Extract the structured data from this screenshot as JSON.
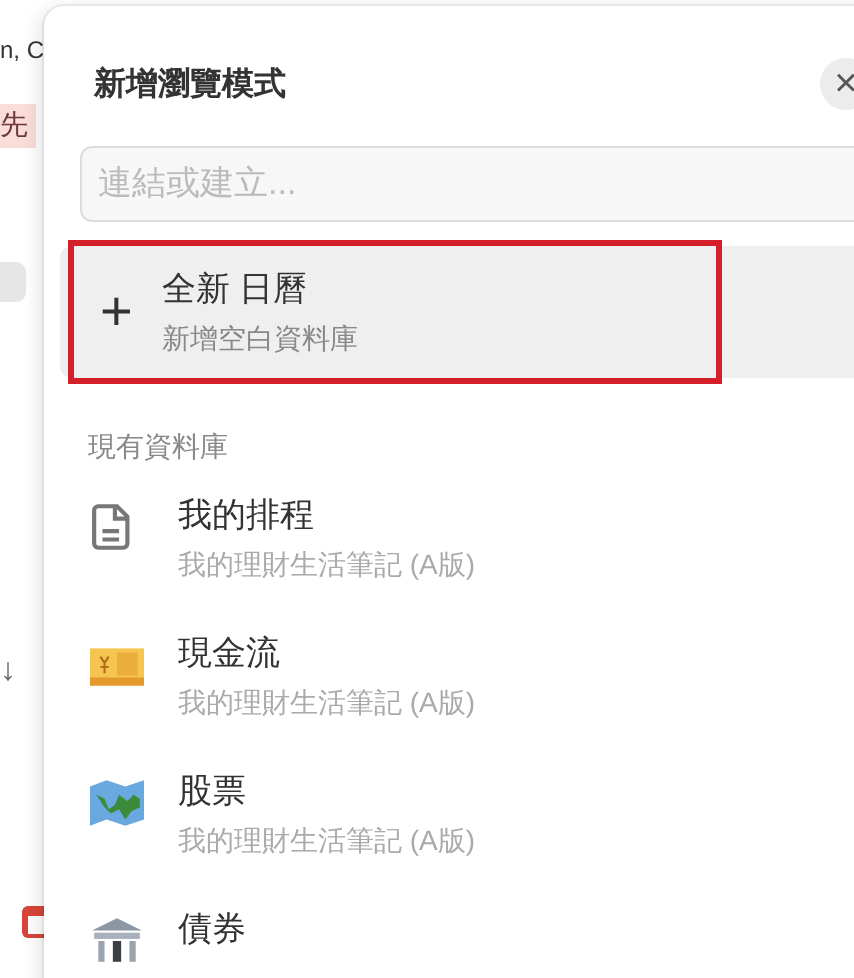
{
  "background": {
    "texts": [
      {
        "kind": "plain",
        "text": "n, C"
      },
      {
        "kind": "tag",
        "text": "先"
      },
      {
        "kind": "chip"
      },
      {
        "kind": "arrow",
        "text": "↓"
      },
      {
        "kind": "calendar"
      }
    ]
  },
  "dialog": {
    "title": "新增瀏覽模式",
    "close": "×",
    "search": {
      "placeholder": "連結或建立..."
    },
    "new_item": {
      "icon": "+",
      "title": "全新 日曆",
      "subtitle": "新增空白資料庫",
      "highlighted": true
    },
    "section_label": "現有資料庫",
    "databases": [
      {
        "kind": "page",
        "title": "我的排程",
        "subtitle": "我的理財生活筆記 (A版)"
      },
      {
        "kind": "cash",
        "title": "現金流",
        "subtitle": "我的理財生活筆記 (A版)"
      },
      {
        "kind": "map",
        "title": "股票",
        "subtitle": "我的理財生活筆記 (A版)"
      },
      {
        "kind": "bank",
        "title": "債券"
      }
    ]
  }
}
